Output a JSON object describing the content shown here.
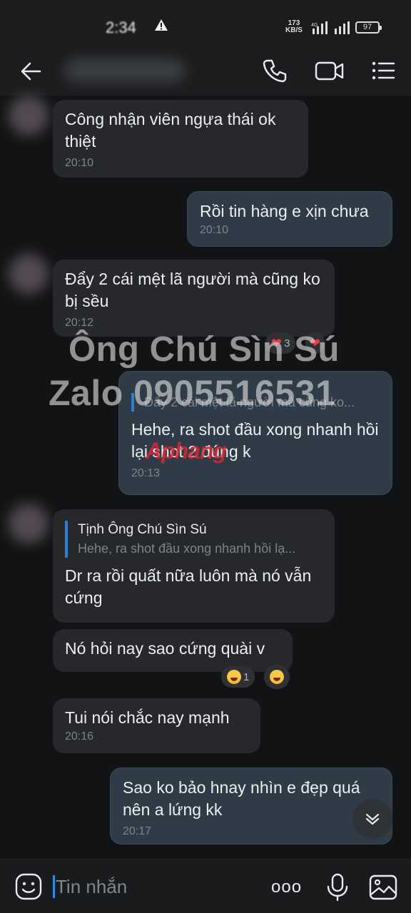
{
  "status_bar": {
    "time": "2:34",
    "speed_value": "173",
    "speed_unit": "KB/S",
    "network": "4G",
    "battery": "97"
  },
  "header": {
    "contact_name": "",
    "icons": [
      "back-arrow-icon",
      "phone-icon",
      "video-camera-icon",
      "menu-list-icon"
    ]
  },
  "messages": [
    {
      "side": "in",
      "text": "Công nhận viên ngựa thái ok thiệt",
      "time": "20:10"
    },
    {
      "side": "out",
      "text": "Rồi tin hàng e xịn chưa",
      "time": "20:10"
    },
    {
      "side": "in",
      "text": "Đẩy 2 cái mệt lã người mà cũng ko bị sều",
      "time": "20:12",
      "reaction_count": "3"
    },
    {
      "side": "out",
      "quote": "Đẩy 2 cái mệt lã người mà cũng ko...",
      "text": "Hehe, ra shot đầu xong nhanh hồi lại shot 2 đúng k",
      "time": "20:13"
    },
    {
      "side": "in",
      "quote_author": "Tịnh Ông Chú Sìn Sú",
      "quote": "Hehe, ra shot đầu xong nhanh hồi lạ...",
      "text": "Dr ra rồi quất nữa luôn mà nó vẫn cứng"
    },
    {
      "side": "in",
      "text": "Nó hỏi nay sao cứng quài v",
      "reaction_count": "1"
    },
    {
      "side": "in",
      "text": "Tui nói chắc nay mạnh",
      "time": "20:16"
    },
    {
      "side": "out",
      "text": "Sao ko bảo hnay nhìn e đẹp quá nên a lứng kk",
      "time": "20:17"
    }
  ],
  "watermark": {
    "line1": "Ông Chú Sìn Sú",
    "line2": "Zalo 0905516531",
    "logo": "Aphang"
  },
  "input_bar": {
    "placeholder": "Tin nhắn",
    "more_label": "ooo",
    "icons": [
      "emoji-icon",
      "more-icon",
      "microphone-icon",
      "image-icon"
    ]
  },
  "colors": {
    "background": "#121314",
    "bubble_in": "#26282b",
    "bubble_out": "#2f3c47",
    "accent": "#2a7fd0"
  }
}
